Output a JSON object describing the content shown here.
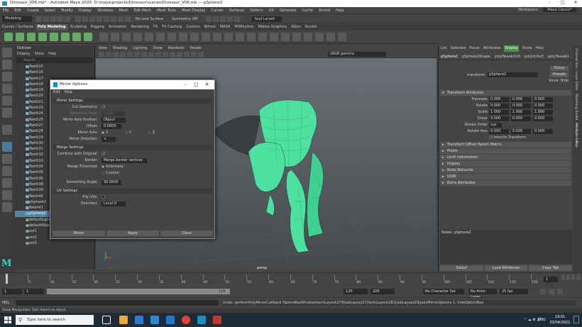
{
  "window": {
    "title": "Dinosaur_V06.mb* - Autodesk Maya 2020: D:\\maya\\projects\\Dinosaur\\scenes\\Dinosaur_V06.mb  ---  pSphere2"
  },
  "menubar": [
    "File",
    "Edit",
    "Create",
    "Select",
    "Modify",
    "Display",
    "Windows",
    "Mesh",
    "Edit Mesh",
    "Mesh Tools",
    "Mesh Display",
    "Curves",
    "Surfaces",
    "Deform",
    "UV",
    "Generate",
    "Cache",
    "Arnold",
    "Help"
  ],
  "workspace": {
    "label": "Workspace :",
    "value": "Maya Classic*"
  },
  "statusline": {
    "mode": "Modeling",
    "no_live_surface": "No Live Surface",
    "symmetry": "Symmetry: Off",
    "user": "Seyf.Larash"
  },
  "shelf_tabs": [
    "Curves / Surfaces",
    "Poly Modeling",
    "Sculpting",
    "Rigging",
    "Animation",
    "Rendering",
    "FX",
    "FX Caching",
    "Custom",
    "Bifrost",
    "MASH",
    "MSRhythm",
    "Motion Graphics",
    "XGen",
    "Arnold"
  ],
  "shelf_active": "Poly Modeling",
  "outliner": {
    "title": "Outliner",
    "menu": [
      "Display",
      "Show",
      "Help"
    ],
    "search_placeholder": "Search...",
    "items": [
      "Teeth15",
      "Teeth16",
      "Teeth17",
      "Teeth18",
      "Teeth19",
      "Teeth20",
      "Teeth21",
      "Teeth23",
      "Teeth24",
      "Teeth25",
      "Teeth27",
      "Teeth28",
      "Teeth29",
      "Teeth30",
      "Teeth31",
      "Teeth32",
      "Teeth33",
      "Teeth34",
      "Teeth35",
      "Teeth36",
      "Teeth38",
      "Teeth39",
      "Teeth40",
      "pSphere1",
      "Teeth41",
      "pSphere2",
      "defaultLightSet",
      "defaultObjectSet",
      "set1",
      "set2",
      "set3"
    ],
    "selected": "pSphere2"
  },
  "viewport": {
    "menu": [
      "View",
      "Shading",
      "Lighting",
      "Show",
      "Renderer",
      "Panels"
    ],
    "color_space": "sRGB gamma",
    "camera_label": "persp"
  },
  "mirror_dialog": {
    "title": "Mirror Options",
    "menu": [
      "Edit",
      "Help"
    ],
    "sections": {
      "mirror_settings": "Mirror Settings",
      "merge_settings": "Merge Settings",
      "uv_settings": "UV Settings"
    },
    "fields": {
      "cut_geometry": "Cut Geometry:",
      "geometry_type": "Geometry Type:",
      "geometry_type_value": "Copy",
      "mirror_axis_position": "Mirror Axis Position:",
      "mirror_axis_position_value": "Object",
      "offset": "Offset:",
      "offset_value": "0.0000",
      "mirror_axis": "Mirror Axis:",
      "axis_x": "X",
      "axis_y": "Y",
      "axis_z": "Z",
      "mirror_direction": "Mirror Direction:",
      "mirror_direction_value": "+",
      "combine_with_original": "Combine with Original:",
      "border": "Border:",
      "border_value": "Merge border vertices",
      "merge_threshold": "Merge Threshold:",
      "merge_automatic": "Automatic",
      "merge_custom": "Custom",
      "smoothing_angle": "Smoothing Angle:",
      "smoothing_angle_value": "30.0000",
      "flip_uvs": "Flip UVs:",
      "direction": "Direction:",
      "direction_value": "Local U"
    },
    "buttons": {
      "mirror": "Mirror",
      "apply": "Apply",
      "close": "Close"
    }
  },
  "attribute_editor": {
    "menu": [
      "List",
      "Selected",
      "Focus",
      "Attributes",
      "Display",
      "Show",
      "Help"
    ],
    "menu_highlight": "Display",
    "node_tabs": [
      "pSphere2",
      "pSphere2Shape",
      "polyTweakUV9",
      "polyUnite3",
      "polyTweakU"
    ],
    "transform_label": "transform:",
    "transform_value": "pSphere2",
    "buttons": {
      "focus": "Focus",
      "presets": "Presets",
      "show": "Show",
      "hide": "Hide"
    },
    "sections": [
      "Transform Attributes",
      "Transform Offset Parent Matrix",
      "Pivots",
      "Limit Information",
      "Display",
      "Node Behavior",
      "UUID",
      "Extra Attributes"
    ],
    "transform_rows": [
      {
        "label": "Translate",
        "values": [
          "0.000",
          "0.000",
          "0.000"
        ]
      },
      {
        "label": "Rotate",
        "values": [
          "0.000",
          "0.000",
          "0.000"
        ]
      },
      {
        "label": "Scale",
        "values": [
          "1.000",
          "1.000",
          "1.000"
        ]
      },
      {
        "label": "Shear",
        "values": [
          "0.000",
          "0.000",
          "0.000"
        ]
      }
    ],
    "rotate_order_label": "Rotate Order",
    "rotate_order_value": "xyz",
    "rotate_axis_label": "Rotate Axis",
    "rotate_axis_values": [
      "0.000",
      "0.000",
      "0.000"
    ],
    "inherits_transform": "Inherits Transform",
    "notes_label": "Notes: pSphere2",
    "bottom_buttons": [
      "Select",
      "Load Attributes",
      "Copy Tab"
    ]
  },
  "side_tabs": [
    "Channel Box / Layer Editor",
    "Modelling Toolkit",
    "Attribute Editor"
  ],
  "timeslider": {
    "ticks": [
      "1",
      "5",
      "10",
      "15",
      "20",
      "25",
      "30",
      "35",
      "40",
      "45",
      "50",
      "55",
      "60",
      "65",
      "70",
      "75",
      "80",
      "85",
      "90",
      "95",
      "100",
      "105",
      "110",
      "115",
      "120"
    ],
    "current": "1"
  },
  "range": {
    "start": "1",
    "start2": "1",
    "range_end_display": "120",
    "end": "120",
    "end2": "200",
    "character_set": "No Character Set",
    "anim_layer": "No Anim Layer",
    "fps": "25 fps"
  },
  "command": {
    "label": "MEL",
    "result": "Undo: performPolyMirrorCallback OptionBoxWindow|formLayout279|tabLayout27|formLayout281|tabLayout29|polyMirrorOptions 1; hideOptionBox"
  },
  "helpline": "Show Manipulator Tool: Select an object.",
  "taskbar": {
    "search_placeholder": "Type here to search",
    "lang": "ENG",
    "time": "19:01",
    "date": "03/04/2021"
  }
}
